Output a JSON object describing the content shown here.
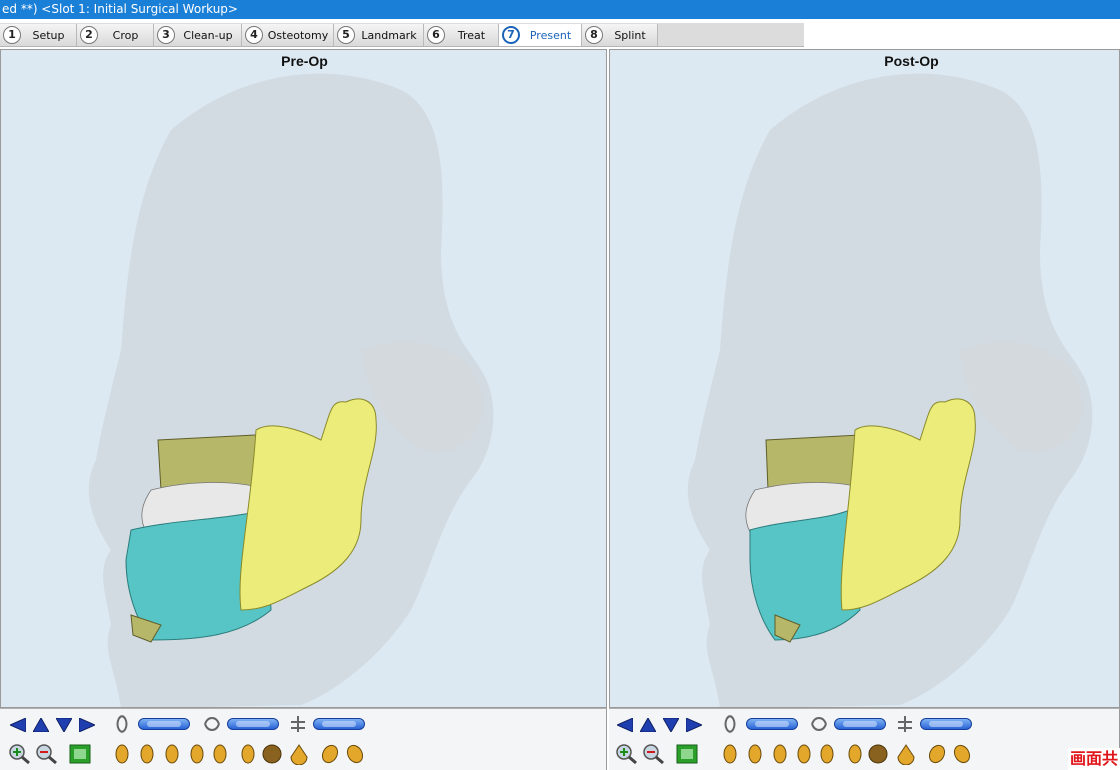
{
  "window": {
    "title": "ed **) <Slot 1: Initial Surgical Workup>"
  },
  "tabs": [
    {
      "num": "1",
      "label": "Setup"
    },
    {
      "num": "2",
      "label": "Crop"
    },
    {
      "num": "3",
      "label": "Clean-up"
    },
    {
      "num": "4",
      "label": "Osteotomy"
    },
    {
      "num": "5",
      "label": "Landmark"
    },
    {
      "num": "6",
      "label": "Treat"
    },
    {
      "num": "7",
      "label": "Present"
    },
    {
      "num": "8",
      "label": "Splint"
    }
  ],
  "active_tab": "Present",
  "viewports": {
    "left": {
      "title": "Pre-Op"
    },
    "right": {
      "title": "Post-Op"
    }
  },
  "colors": {
    "titlebar": "#1a7fd6",
    "viewport_bg": "#dde9f2",
    "soft_tissue": "#c9cfd6",
    "mandible": "#ecec7a",
    "maxilla": "#b7b76a",
    "teeth": "#e8e8e8",
    "lower_face": "#57c5c5",
    "accent": "#1a63b8"
  },
  "icons": {
    "nav": [
      "arrow-left-icon",
      "arrow-up-icon",
      "arrow-down-icon",
      "arrow-right-icon"
    ],
    "rotate": [
      "rotate-pitch-icon",
      "rotate-yaw-icon",
      "rotate-roll-icon"
    ],
    "zoom": [
      "zoom-in-icon",
      "zoom-out-icon",
      "fit-view-icon"
    ],
    "head_views": [
      "head-view-1-icon",
      "head-view-2-icon",
      "head-view-3-icon",
      "head-view-4-icon",
      "head-view-5-icon",
      "head-view-6-icon",
      "head-view-7-icon",
      "head-view-8-icon",
      "head-view-9-icon",
      "head-view-10-icon"
    ]
  },
  "watermark": "画面共"
}
